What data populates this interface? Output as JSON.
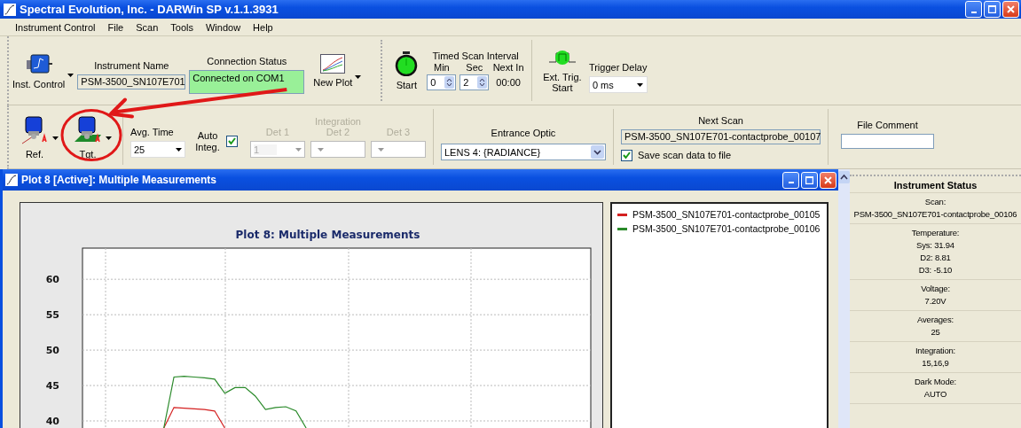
{
  "window": {
    "title": "Spectral Evolution, Inc. - DARWin SP v.1.1.3931"
  },
  "menu": [
    "Instrument Control",
    "File",
    "Scan",
    "Tools",
    "Window",
    "Help"
  ],
  "toolbar1": {
    "inst_control": {
      "label": "Inst. Control"
    },
    "instrument_name": {
      "label": "Instrument Name",
      "value": "PSM-3500_SN107E701"
    },
    "connection_status": {
      "label": "Connection Status",
      "value": "Connected on COM1",
      "connected": true
    },
    "new_plot": {
      "label": "New Plot"
    },
    "start": {
      "label": "Start"
    },
    "timed_scan": {
      "title": "Timed Scan Interval",
      "min": {
        "label": "Min",
        "value": "0"
      },
      "sec": {
        "label": "Sec",
        "value": "2"
      },
      "next_in": {
        "label": "Next In",
        "value": "00:00"
      }
    },
    "ext_trig": {
      "label": "Ext. Trig. Start"
    },
    "trigger_delay": {
      "label": "Trigger Delay",
      "value": "0 ms"
    }
  },
  "toolbar2": {
    "ref": {
      "label": "Ref."
    },
    "tgt": {
      "label": "Tgt."
    },
    "avg_time": {
      "label": "Avg. Time",
      "value": "25"
    },
    "auto_integ": {
      "label": "Auto Integ.",
      "checked": true
    },
    "integration": {
      "title": "Integration",
      "disabled": true,
      "detectors": [
        {
          "label": "Det 1",
          "value": "1"
        },
        {
          "label": "Det 2"
        },
        {
          "label": "Det 3"
        }
      ]
    },
    "entrance_optic": {
      "label": "Entrance Optic",
      "value": "LENS 4: {RADIANCE}"
    },
    "next_scan": {
      "label": "Next Scan",
      "value": "PSM-3500_SN107E701-contactprobe_00107",
      "save": {
        "label": "Save scan data to file",
        "checked": true
      }
    },
    "file_comment": {
      "label": "File Comment"
    }
  },
  "plot": {
    "title": "Plot 8 [Active]: Multiple Measurements",
    "chart_data": {
      "type": "line",
      "title": "Plot 8: Multiple Measurements",
      "categories": [
        null,
        null,
        null,
        null,
        null,
        null,
        null,
        null,
        null,
        null,
        null,
        null,
        null,
        null,
        null,
        null,
        null,
        null,
        null,
        null,
        null,
        null,
        null,
        null,
        null,
        null,
        null,
        null,
        null,
        null,
        null,
        null,
        null,
        null,
        null,
        null,
        null,
        null,
        null,
        null,
        null,
        null,
        null,
        null,
        null,
        null,
        null,
        null,
        null,
        null,
        null
      ],
      "ylim": [
        38.5,
        64.4
      ],
      "grid": true,
      "yticks": [
        40,
        45,
        50,
        55,
        60
      ],
      "series": [
        {
          "name": "PSM-3500_SN107E701-contactprobe_00105",
          "color": "#d42020",
          "values": [
            null,
            null,
            null,
            null,
            null,
            null,
            null,
            null,
            39,
            41.9,
            41.8,
            41.7,
            41.6,
            41.4,
            39,
            null,
            null,
            null,
            null,
            null,
            null,
            null,
            null,
            null,
            null,
            null,
            null,
            null,
            null,
            null,
            null,
            null,
            null,
            null,
            null,
            null,
            null,
            null,
            null,
            null,
            null,
            null,
            null,
            null,
            null,
            null,
            null,
            null,
            null,
            null,
            null
          ]
        },
        {
          "name": "PSM-3500_SN107E701-contactprobe_00106",
          "color": "#2a8a2a",
          "values": [
            null,
            null,
            null,
            null,
            null,
            null,
            null,
            null,
            39,
            46.2,
            46.3,
            46.2,
            46.1,
            45.9,
            43.9,
            44.7,
            44.7,
            43.5,
            41.6,
            41.9,
            42.0,
            41.4,
            39,
            null,
            null,
            null,
            null,
            null,
            null,
            null,
            null,
            null,
            null,
            null,
            null,
            null,
            null,
            null,
            null,
            null,
            null,
            null,
            null,
            null,
            null,
            null,
            null,
            null,
            null,
            null,
            null
          ]
        }
      ]
    }
  },
  "instrument_status": {
    "title": "Instrument Status",
    "sections": [
      {
        "label": "Scan:",
        "values": [
          "PSM-3500_SN107E701-contactprobe_00106"
        ]
      },
      {
        "label": "Temperature:",
        "values": [
          "Sys: 31.94",
          "D2: 8.81",
          "D3: -5.10"
        ]
      },
      {
        "label": "Voltage:",
        "values": [
          "7.20V"
        ]
      },
      {
        "label": "Averages:",
        "values": [
          "25"
        ]
      },
      {
        "label": "Integration:",
        "values": [
          "15,16,9"
        ]
      },
      {
        "label": "Dark Mode:",
        "values": [
          "AUTO"
        ]
      }
    ]
  }
}
